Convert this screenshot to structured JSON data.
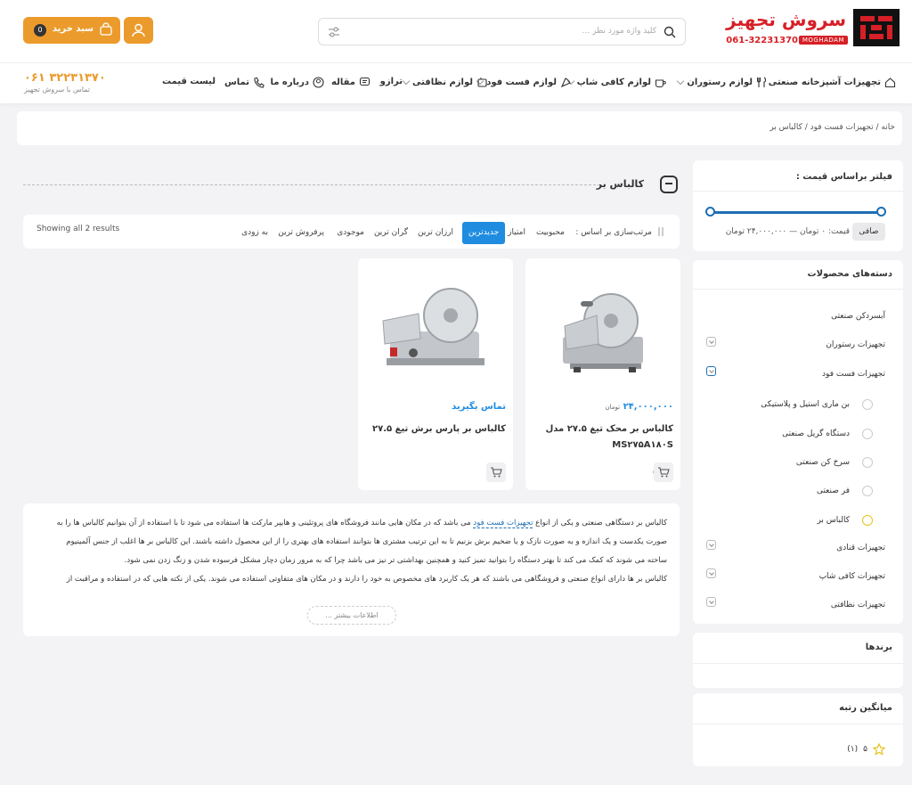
{
  "logo": {
    "title": "سروش تجهیز",
    "phone": "061-32231370",
    "badge": "MOGHADAM"
  },
  "search": {
    "placeholder": "کلید واژه مورد نظر ..."
  },
  "cart": {
    "label": "سبد خرید",
    "count": "0"
  },
  "nav": {
    "items": [
      {
        "label": "تجهیزات آشپزخانه صنعتی"
      },
      {
        "label": "لوازم رستوران"
      },
      {
        "label": "لوازم کافی شاپ"
      },
      {
        "label": "لوازم فست فود"
      },
      {
        "label": "لوازم نظافتی"
      },
      {
        "label": "ترازو"
      },
      {
        "label": "مقاله"
      },
      {
        "label": "درباره ما"
      },
      {
        "label": "تماس"
      },
      {
        "label": "لیست قیمت"
      }
    ],
    "phone": "۰۶۱ ۳۲۲۳۱۳۷۰",
    "phone_sub": "تماس با سروش تجهیز"
  },
  "breadcrumb": "خانه / تجهیزات فست فود / کالباس بر",
  "filter": {
    "title": "فیلتر براساس قیمت :",
    "button": "صافی",
    "range_text": "قیمت: ۰ تومان — ۲۴,۰۰۰,۰۰۰ تومان"
  },
  "categories": {
    "title": "دسته‌های محصولات",
    "items": [
      {
        "label": "آبسردکن صنعتی"
      },
      {
        "label": "تجهیزات رستوران"
      },
      {
        "label": "تجهیزات فست فود"
      },
      {
        "label": "تجهیزات قنادی"
      },
      {
        "label": "تجهیزات کافی شاپ"
      },
      {
        "label": "تجهیزات نظافتی"
      }
    ],
    "sub": [
      {
        "label": "بن ماری استیل و پلاستیکی"
      },
      {
        "label": "دستگاه گریل صنعتی"
      },
      {
        "label": "سرخ کن صنعتی"
      },
      {
        "label": "فر صنعتی"
      },
      {
        "label": "کالباس بر"
      }
    ]
  },
  "brands": {
    "title": "برندها"
  },
  "rating": {
    "title": "میانگین رتبه",
    "value": "۵",
    "count": "(۱)"
  },
  "page": {
    "title": "کالباس بر"
  },
  "sort": {
    "label": "مرتب‌سازی بر اساس :",
    "options": [
      "محبوبیت",
      "امتیاز",
      "جدیدترین",
      "ارزان ترین",
      "گران ترین",
      "موجودی",
      "پرفروش ترین",
      "به زودی"
    ],
    "results": "Showing all 2 results"
  },
  "products": [
    {
      "price": "۲۴,۰۰۰,۰۰۰",
      "currency": "تومان",
      "name": "کالباس بر محک تیغ ۲۷.۵ مدل MS۲۷۵A۱۸۰S",
      "rating": "۵"
    },
    {
      "price": "تماس بگیرید",
      "name": "کالباس بر پارس برش تیغ ۲۷.۵"
    }
  ],
  "description": {
    "line1a": "کالباس بر دستگاهی صنعتی و یکی از انواع",
    "link": "تجهیزات فست فود",
    "line1b": "می باشد که در مکان هایی مانند فروشگاه های پروتئینی و هایپر مارکت ها استفاده می شود تا با استفاده از آن بتوانیم کالباس ها را به",
    "line2": "صورت یکدست و یک اندازه و به صورت نازک و یا ضخیم برش بزنیم تا به این ترتیب مشتری ها بتوانند استفاده های بهتری را از این محصول داشته باشند. این کالباس بر ها اغلب از جنس آلمینیوم",
    "line3": "ساخته می شوند که کمک می کند تا بهتر دستگاه را بتوانید تمیز کنید و همچنین بهداشتی تر نیز می باشد چرا که به مرور زمان دچار مشکل فرسوده شدن و زنگ زدن نمی شود.",
    "line4": "کالباس بر ها دارای انواع صنعتی و فروشگاهی می باشند که هر یک کاربرد های مخصوص به خود را دارند و در مکان های متفاوتی استفاده می شوند. یکی از نکته هایی که در استفاده و مراقبت از",
    "more": "اطلاعات بیشتر ..."
  }
}
